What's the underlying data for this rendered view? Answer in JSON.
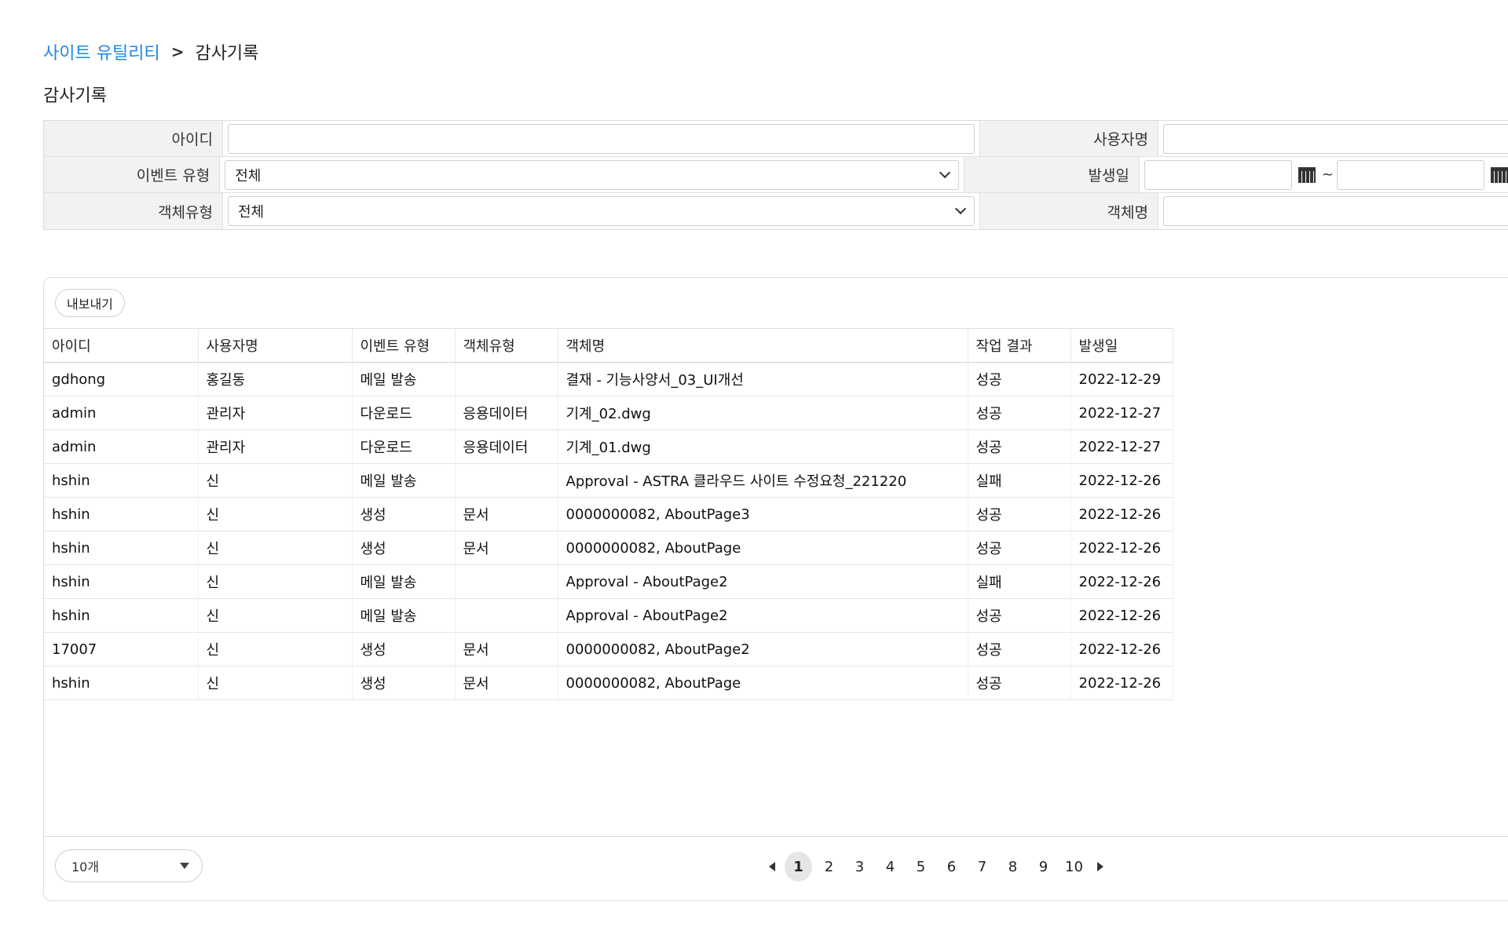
{
  "breadcrumb": {
    "root": "사이트 유틸리티",
    "separator": ">",
    "current": "감사기록"
  },
  "page_title": "감사기록",
  "search": {
    "id_label": "아이디",
    "username_label": "사용자명",
    "event_type_label": "이벤트 유형",
    "event_type_value": "전체",
    "date_label": "발생일",
    "date_separator": "~",
    "object_type_label": "객체유형",
    "object_type_value": "전체",
    "object_name_label": "객체명"
  },
  "toolbar": {
    "export_label": "내보내기"
  },
  "table": {
    "columns": [
      "아이디",
      "사용자명",
      "이벤트 유형",
      "객체유형",
      "객체명",
      "작업 결과",
      "발생일"
    ],
    "rows": [
      [
        "gdhong",
        "홍길동",
        "메일 발송",
        "",
        "결재 - 기능사양서_03_UI개선",
        "성공",
        "2022-12-29"
      ],
      [
        "admin",
        "관리자",
        "다운로드",
        "응용데이터",
        "기계_02.dwg",
        "성공",
        "2022-12-27"
      ],
      [
        "admin",
        "관리자",
        "다운로드",
        "응용데이터",
        "기계_01.dwg",
        "성공",
        "2022-12-27"
      ],
      [
        "hshin",
        "신",
        "메일 발송",
        "",
        "Approval - ASTRA 클라우드 사이트 수정요청_221220",
        "실패",
        "2022-12-26"
      ],
      [
        "hshin",
        "신",
        "생성",
        "문서",
        "0000000082, AboutPage3",
        "성공",
        "2022-12-26"
      ],
      [
        "hshin",
        "신",
        "생성",
        "문서",
        "0000000082, AboutPage",
        "성공",
        "2022-12-26"
      ],
      [
        "hshin",
        "신",
        "메일 발송",
        "",
        "Approval - AboutPage2",
        "실패",
        "2022-12-26"
      ],
      [
        "hshin",
        "신",
        "메일 발송",
        "",
        "Approval - AboutPage2",
        "성공",
        "2022-12-26"
      ],
      [
        "17007",
        "신",
        "생성",
        "문서",
        "0000000082, AboutPage2",
        "성공",
        "2022-12-26"
      ],
      [
        "hshin",
        "신",
        "생성",
        "문서",
        "0000000082, AboutPage",
        "성공",
        "2022-12-26"
      ]
    ]
  },
  "footer": {
    "page_size_value": "10개",
    "pages": [
      "1",
      "2",
      "3",
      "4",
      "5",
      "6",
      "7",
      "8",
      "9",
      "10"
    ],
    "current_page": "1"
  },
  "colors": {
    "breadcrumb_link": "#1e88e5",
    "label_bg": "#f2f2f2",
    "active_page_bg": "#e6e6e6"
  }
}
